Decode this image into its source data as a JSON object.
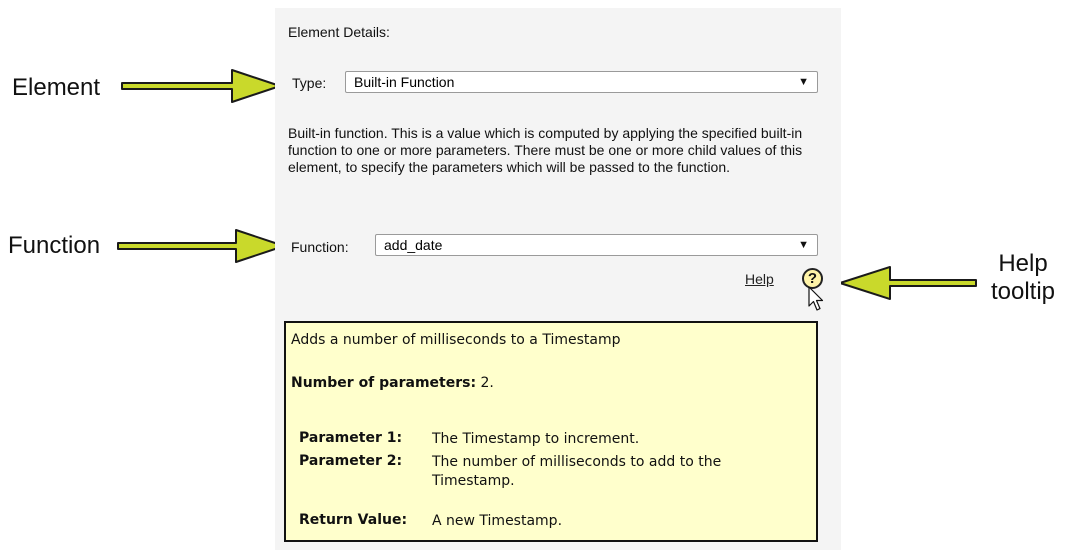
{
  "details": {
    "section_title": "Element Details:",
    "type_label": "Type:",
    "type_value": "Built-in Function",
    "description": "Built-in function. This is a value which is computed by applying the specified built-in function to one or more parameters. There must be one or more child values of this element, to specify the parameters which will be passed to the function.",
    "function_label": "Function:",
    "function_value": "add_date",
    "help_link": "Help",
    "help_icon_glyph": "?"
  },
  "tooltip": {
    "summary": "Adds a number of milliseconds to a Timestamp",
    "param_count_label": "Number of parameters:",
    "param_count_value": " 2.",
    "rows": [
      {
        "key": "Parameter 1:",
        "value": "The Timestamp to increment."
      },
      {
        "key": "Parameter 2:",
        "value": "The number of milliseconds to add to the Timestamp."
      },
      {
        "key": "Return Value:",
        "value": "A new Timestamp."
      }
    ]
  },
  "callouts": {
    "element": "Element",
    "function": "Function",
    "help_line1": "Help",
    "help_line2": "tooltip"
  },
  "colors": {
    "arrow": "#c9d92b",
    "tooltip_bg": "#ffffcc",
    "panel_bg": "#f4f4f4"
  }
}
